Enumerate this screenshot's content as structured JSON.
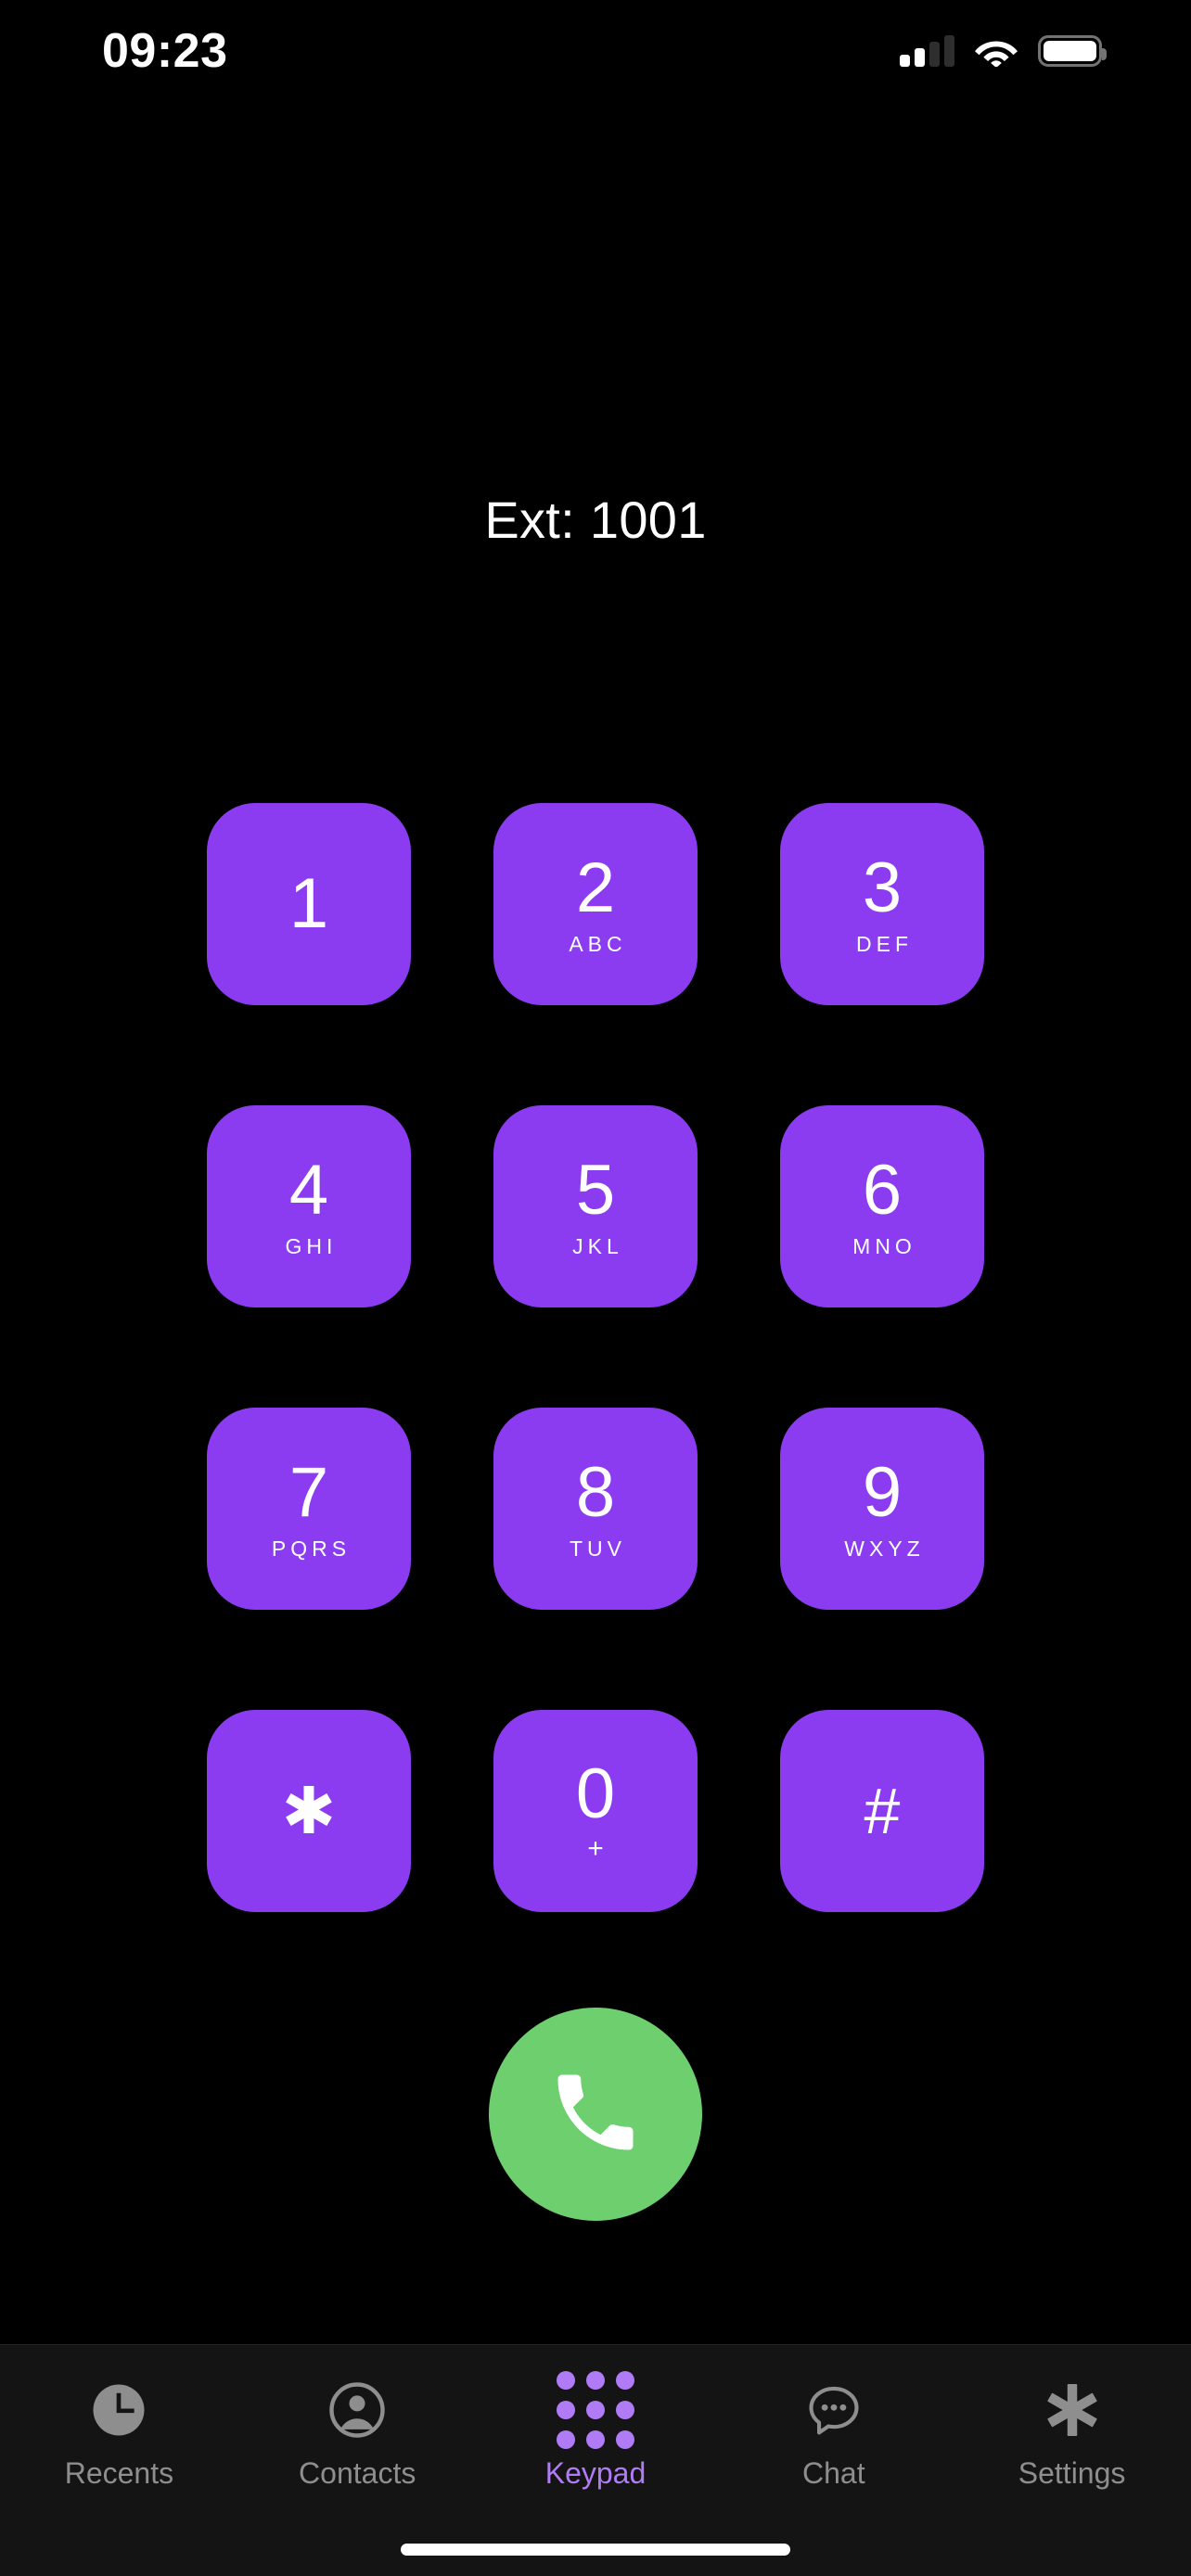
{
  "status_bar": {
    "time": "09:23",
    "cellular_icon": "cellular-signal-icon",
    "cellular_bars_filled": 2,
    "cellular_bars_total": 4,
    "wifi_icon": "wifi-icon",
    "battery_icon": "battery-icon",
    "battery_full": true
  },
  "header": {
    "extension_label": "Ext: 1001"
  },
  "colors": {
    "background": "#000000",
    "key_purple": "#8B3CF0",
    "call_green": "#6ECF6E",
    "accent_purple": "#B07CF5",
    "tabbar_background": "#141414",
    "inactive_tab": "#8E8E8E"
  },
  "keypad": {
    "keys": [
      {
        "digit": "1",
        "letters": ""
      },
      {
        "digit": "2",
        "letters": "ABC"
      },
      {
        "digit": "3",
        "letters": "DEF"
      },
      {
        "digit": "4",
        "letters": "GHI"
      },
      {
        "digit": "5",
        "letters": "JKL"
      },
      {
        "digit": "6",
        "letters": "MNO"
      },
      {
        "digit": "7",
        "letters": "PQRS"
      },
      {
        "digit": "8",
        "letters": "TUV"
      },
      {
        "digit": "9",
        "letters": "WXYZ"
      },
      {
        "digit": "✱",
        "letters": ""
      },
      {
        "digit": "0",
        "letters": "+"
      },
      {
        "digit": "#",
        "letters": ""
      }
    ]
  },
  "call_button": {
    "icon": "phone-handset-icon",
    "label": ""
  },
  "tabbar": {
    "items": [
      {
        "label": "Recents",
        "icon": "clock-icon",
        "active": false
      },
      {
        "label": "Contacts",
        "icon": "person-circle-icon",
        "active": false
      },
      {
        "label": "Keypad",
        "icon": "keypad-dots-icon",
        "active": true
      },
      {
        "label": "Chat",
        "icon": "speech-bubble-icon",
        "active": false
      },
      {
        "label": "Settings",
        "icon": "asterisk-icon",
        "active": false
      }
    ]
  },
  "home_indicator": {
    "name": "home-indicator"
  }
}
